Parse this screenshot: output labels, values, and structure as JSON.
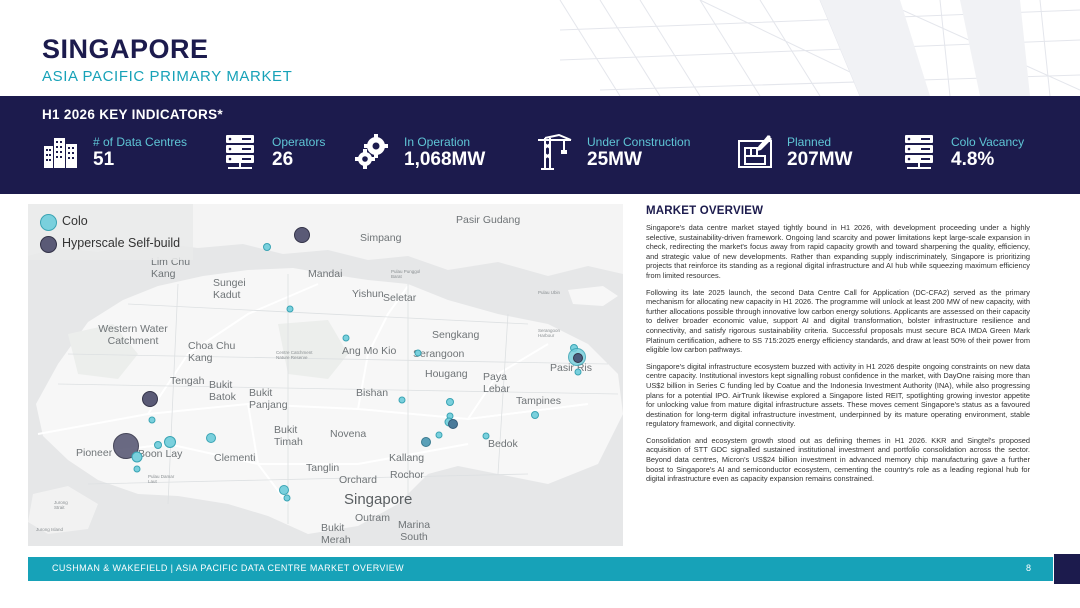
{
  "header": {
    "title": "SINGAPORE",
    "subtitle": "ASIA PACIFIC PRIMARY MARKET"
  },
  "kpi_band": {
    "heading": "H1 2026 KEY INDICATORS*",
    "items": [
      {
        "label": "# of Data Centres",
        "value": "51",
        "icon": "buildings-icon"
      },
      {
        "label": "Operators",
        "value": "26",
        "icon": "server-rack-icon"
      },
      {
        "label": "In Operation",
        "value": "1,068MW",
        "icon": "gears-icon"
      },
      {
        "label": "Under Construction",
        "value": "25MW",
        "icon": "crane-icon"
      },
      {
        "label": "Planned",
        "value": "207MW",
        "icon": "blueprint-icon"
      },
      {
        "label": "Colo Vacancy",
        "value": "4.8%",
        "icon": "server-rack-icon"
      }
    ]
  },
  "map": {
    "legend": [
      {
        "label": "Colo",
        "color": "#5fc6d6"
      },
      {
        "label": "Hyperscale Self-build",
        "color": "#4a4a66"
      }
    ],
    "places": [
      "Pasir Gudang",
      "Simpang",
      "Mandai",
      "Sungei Kadut",
      "Lim Chu Kang",
      "Yishun",
      "Western Water Catchment",
      "Choa Chu Kang",
      "Ang Mo Kio",
      "Serangoon",
      "Sengkang",
      "Hougang",
      "Paya Lebar",
      "Pasir Ris",
      "Tengah",
      "Bukit Batok",
      "Bukit Panjang",
      "Bishan",
      "Tampines",
      "Bukit Timah",
      "Novena",
      "Pioneer",
      "Clementi",
      "Kallang",
      "Bedok",
      "Tanglin",
      "Orchard",
      "Rochor",
      "Singapore",
      "Outram",
      "Marina South",
      "Bukit Merah",
      "Jurong Island",
      "Jurong Strait",
      "Seletar",
      "Pulau Punggol Barat",
      "Pulau Ubin",
      "Serangoon Harbour",
      "Centre Catchment Nature Reserve",
      "Boon Lay",
      "Pulau Damar Laut"
    ]
  },
  "overview": {
    "heading": "MARKET OVERVIEW",
    "paragraphs": [
      "Singapore's data centre market stayed tightly bound in H1 2026, with development proceeding under a highly selective, sustainability-driven framework. Ongoing land scarcity and power limitations kept large-scale expansion in check, redirecting the market's focus away from rapid capacity growth and toward sharpening the quality, efficiency, and strategic value of new developments. Rather than expanding supply indiscriminately, Singapore is prioritizing projects that reinforce its standing as a regional digital infrastructure and AI hub while squeezing maximum efficiency from limited resources.",
      "Following its late 2025 launch, the second Data Centre Call for Application (DC-CFA2) served as the primary mechanism for allocating new capacity in H1 2026. The programme will unlock at least 200 MW of new capacity, with further allocations possible through innovative low carbon energy solutions. Applicants are assessed on their capacity to deliver broader economic value, support AI and digital transformation, bolster infrastructure resilience and connectivity, and satisfy rigorous sustainability criteria. Successful proposals must secure BCA IMDA Green Mark Platinum certification, adhere to SS 715:2025 energy efficiency standards, and draw at least 50% of their power from eligible low carbon pathways.",
      "Singapore's digital infrastructure ecosystem buzzed with activity in H1 2026 despite ongoing constraints on new data centre capacity. Institutional investors kept signalling robust confidence in the market, with DayOne raising more than US$2 billion in Series C funding led by Coatue and the Indonesia Investment Authority (INA), while also progressing plans for a potential IPO. AirTrunk likewise explored a Singapore listed REIT, spotlighting growing investor appetite for unlocking value from mature digital infrastructure assets. These moves cement Singapore's status as a favoured destination for long-term digital infrastructure investment, underpinned by its mature operating environment, stable regulatory framework, and digital connectivity.",
      "Consolidation and ecosystem growth stood out as defining themes in H1 2026. KKR and Singtel's proposed acquisition of STT GDC signalled sustained institutional investment and portfolio consolidation across the sector. Beyond data centres, Micron's US$24 billion investment in advanced memory chip manufacturing gave a further boost to Singapore's AI and semiconductor ecosystem, cementing the country's role as a leading regional hub for digital infrastructure even as capacity expansion remains constrained."
    ]
  },
  "footer": {
    "text": "CUSHMAN & WAKEFIELD  |  ASIA PACIFIC DATA CENTRE MARKET OVERVIEW",
    "page": "8"
  },
  "colors": {
    "navy": "#1c1b4d",
    "teal": "#17a2b8",
    "colo_marker": "#5fc6d6",
    "hyperscale_marker": "#4a4a66"
  }
}
